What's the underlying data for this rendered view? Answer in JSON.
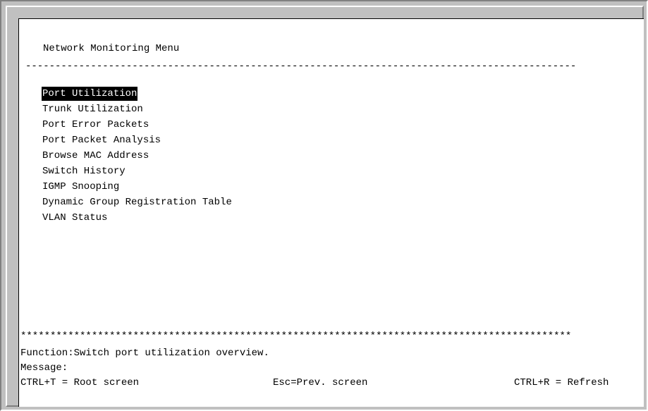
{
  "screen": {
    "title": "Network Monitoring Menu",
    "separator_dash": "---------------------------------------------------------------------------------------------",
    "menu_items": [
      {
        "label": "Port Utilization",
        "selected": true
      },
      {
        "label": "Trunk Utilization",
        "selected": false
      },
      {
        "label": "Port Error Packets",
        "selected": false
      },
      {
        "label": "Port Packet Analysis",
        "selected": false
      },
      {
        "label": "Browse MAC Address",
        "selected": false
      },
      {
        "label": "Switch History",
        "selected": false
      },
      {
        "label": "IGMP Snooping",
        "selected": false
      },
      {
        "label": "Dynamic Group Registration Table",
        "selected": false
      },
      {
        "label": "VLAN Status",
        "selected": false
      }
    ],
    "separator_star": "*********************************************************************************************",
    "function_text": "Function:Switch port utilization overview.",
    "message_text": "Message:",
    "hints": {
      "root": "CTRL+T = Root screen",
      "prev": "Esc=Prev. screen",
      "refresh": "CTRL+R = Refresh"
    }
  }
}
